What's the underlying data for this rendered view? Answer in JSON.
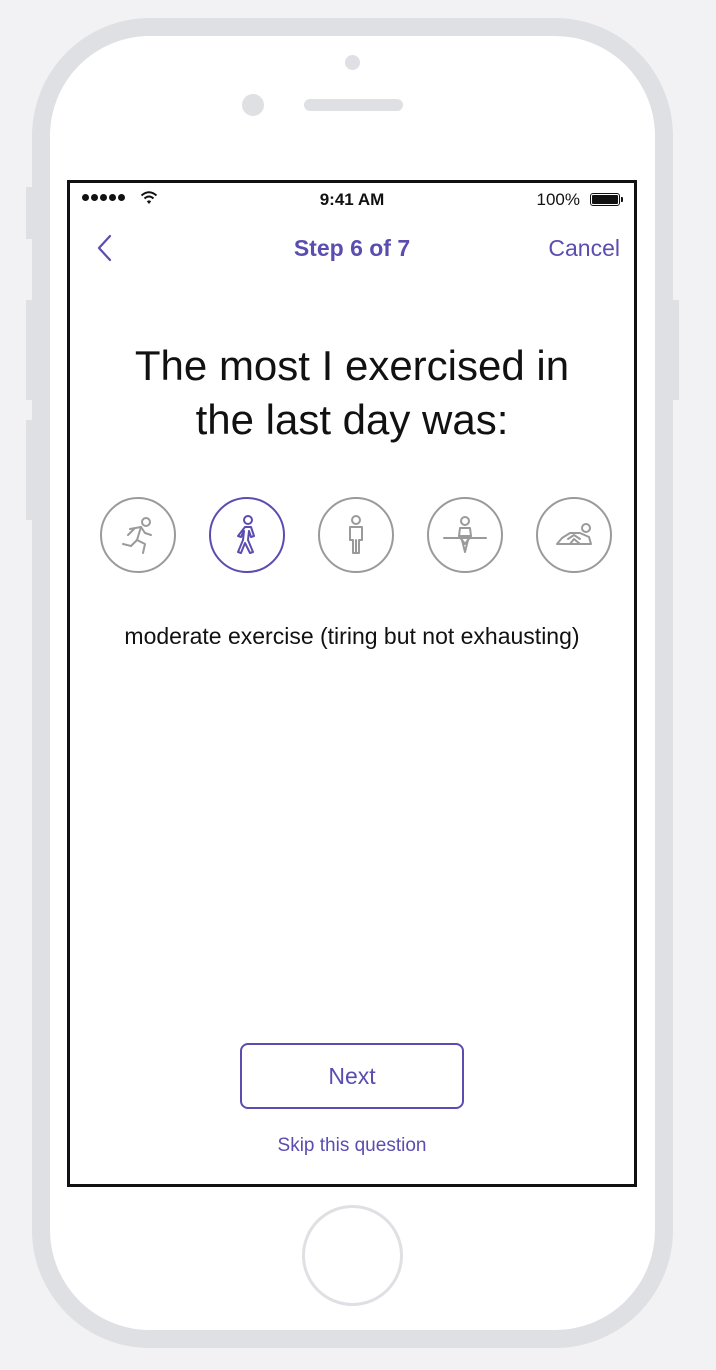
{
  "status_bar": {
    "time": "9:41 AM",
    "battery": "100%"
  },
  "nav": {
    "title": "Step 6 of 7",
    "cancel_label": "Cancel"
  },
  "question": {
    "title": "The most I exercised in the last day was:"
  },
  "options": [
    {
      "icon": "running-icon",
      "selected": false
    },
    {
      "icon": "walking-icon",
      "selected": true
    },
    {
      "icon": "standing-icon",
      "selected": false
    },
    {
      "icon": "sitting-icon",
      "selected": false
    },
    {
      "icon": "lying-icon",
      "selected": false
    }
  ],
  "selected_description": "moderate exercise (tiring but not exhausting)",
  "actions": {
    "next_label": "Next",
    "skip_label": "Skip this question"
  },
  "colors": {
    "accent": "#5b4db0",
    "unselected": "#9a9a9a",
    "frame": "#dfe0e3"
  }
}
